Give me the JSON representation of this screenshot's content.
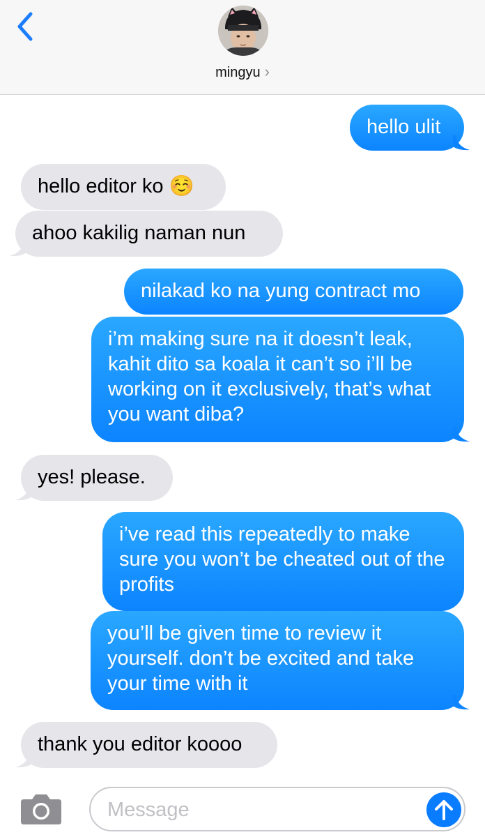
{
  "header": {
    "contact_name": "mingyu",
    "chevron": "›"
  },
  "messages": [
    {
      "side": "out",
      "text": "hello ulit"
    },
    {
      "side": "in",
      "text": "hello editor ko ☺️"
    },
    {
      "side": "in",
      "text": "ahoo kakilig naman nun"
    },
    {
      "side": "out",
      "text": "nilakad ko na yung contract mo"
    },
    {
      "side": "out",
      "text": "i’m making sure na it doesn’t leak, kahit dito sa koala it can’t so i’ll be working on it exclusively, that’s what you want diba?"
    },
    {
      "side": "in",
      "text": "yes! please."
    },
    {
      "side": "out",
      "text": "i’ve read this repeatedly to make sure you won’t be cheated out of the profits"
    },
    {
      "side": "out",
      "text": "you’ll be given time to review it yourself. don’t be excited and take your time with it"
    },
    {
      "side": "in",
      "text": "thank you editor koooo"
    }
  ],
  "composer": {
    "placeholder": "Message",
    "camera_icon": "camera-icon",
    "send_icon": "arrow-up-icon"
  },
  "colors": {
    "outgoing": "#1a93ff",
    "incoming": "#e5e5ea",
    "accent": "#0a7cff"
  }
}
